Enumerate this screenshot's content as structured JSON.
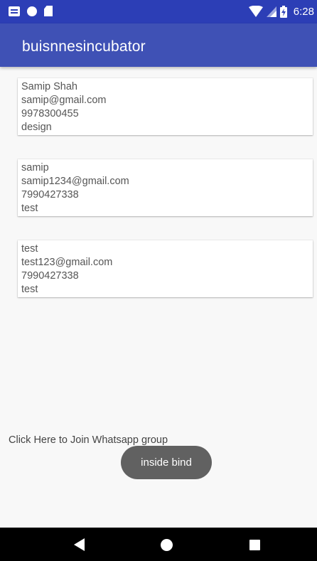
{
  "status_bar": {
    "time": "6:28",
    "icons": [
      "message-notification-icon",
      "circle-notification-icon",
      "sd-card-icon",
      "wifi-icon",
      "cell-signal-icon",
      "battery-charging-icon"
    ]
  },
  "app_bar": {
    "title": "buisnnesincubator"
  },
  "cards": [
    {
      "name": "Samip Shah",
      "email": "samip@gmail.com",
      "phone": "9978300455",
      "category": "design"
    },
    {
      "name": "samip",
      "email": "samip1234@gmail.com",
      "phone": "7990427338",
      "category": "test"
    },
    {
      "name": "test",
      "email": "test123@gmail.com",
      "phone": "7990427338",
      "category": "test"
    }
  ],
  "whatsapp_link": "Click Here to Join Whatsapp group",
  "toast": "inside bind",
  "nav_bar": {
    "buttons": [
      "back-icon",
      "home-icon",
      "recents-icon"
    ]
  },
  "colors": {
    "status_bar": "#2c3eb6",
    "app_bar": "#3f51b5",
    "background": "#f8f8f8",
    "toast": "#616161"
  }
}
